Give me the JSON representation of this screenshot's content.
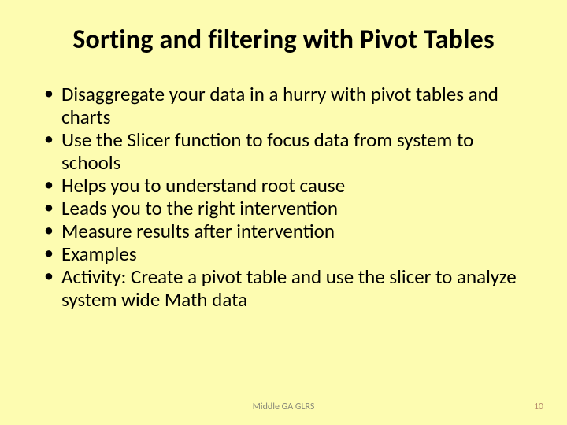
{
  "title": "Sorting and filtering with Pivot Tables",
  "bullets": [
    "Disaggregate your data in a hurry with pivot tables and charts",
    "Use the Slicer function to focus data from system to schools",
    "Helps you to understand root cause",
    "Leads you to the right intervention",
    "Measure results after intervention",
    "Examples",
    "Activity: Create a pivot table and use the slicer to analyze system wide Math data"
  ],
  "footer": {
    "center": "Middle GA GLRS",
    "number": "10"
  }
}
